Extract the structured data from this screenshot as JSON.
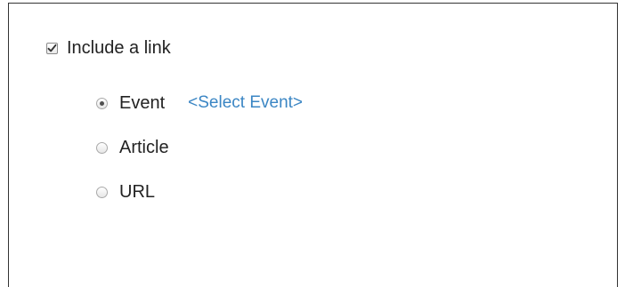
{
  "include_link": {
    "label": "Include a link",
    "checked": true
  },
  "link_type": {
    "selected": "Event",
    "options": [
      {
        "label": "Event",
        "selected": true
      },
      {
        "label": "Article",
        "selected": false
      },
      {
        "label": "URL",
        "selected": false
      }
    ],
    "event_picker_label": "<Select Event>"
  },
  "colors": {
    "link": "#3b86c4",
    "text": "#222222",
    "border": "#333333"
  }
}
